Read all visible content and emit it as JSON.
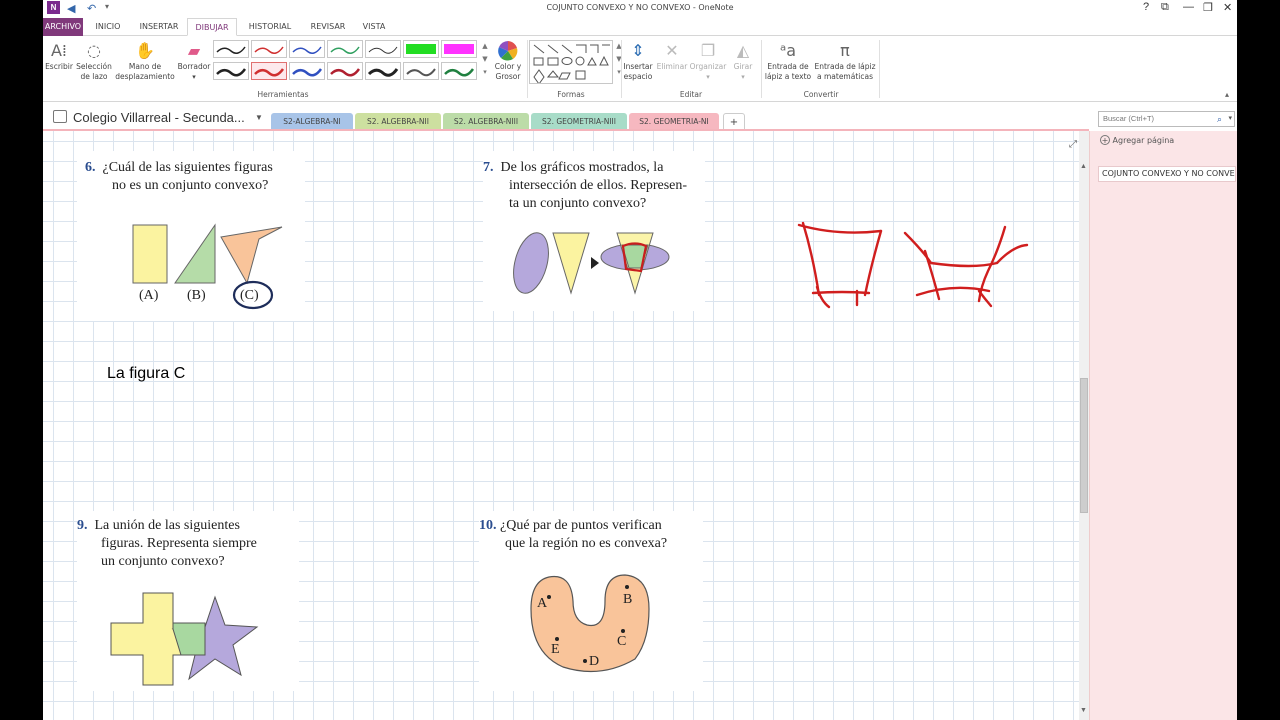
{
  "window": {
    "title": "COJUNTO CONVEXO Y NO CONVEXO - OneNote",
    "logo_text": "N",
    "controls": [
      "?",
      "⧉",
      "—",
      "❐",
      "✕"
    ]
  },
  "tabs": [
    "ARCHIVO",
    "INICIO",
    "INSERTAR",
    "DIBUJAR",
    "HISTORIAL",
    "REVISAR",
    "VISTA"
  ],
  "ribbon": {
    "tools": {
      "write": [
        "Escribir"
      ],
      "lasso": [
        "Selección",
        "de lazo"
      ],
      "pan": [
        "Mano de",
        "desplazamiento"
      ],
      "eraser": [
        "Borrador"
      ],
      "color": [
        "Color y",
        "Grosor"
      ],
      "insert_space": [
        "Insertar",
        "espacio"
      ],
      "delete": [
        "Eliminar"
      ],
      "arrange": [
        "Organizar"
      ],
      "rotate": [
        "Girar"
      ],
      "ink_text": [
        "Entrada de",
        "lápiz a texto"
      ],
      "ink_math": [
        "Entrada de lápiz",
        "a matemáticas"
      ]
    },
    "groups": {
      "tools": "Herramientas",
      "shapes": "Formas",
      "edit": "Editar",
      "convert": "Convertir"
    },
    "pens_row1": [
      "#222222",
      "#d03030",
      "#3050c0",
      "#30a060",
      "#333333",
      "#22dd22",
      "#ff33ff"
    ],
    "pens_row2": [
      "#222222",
      "#d03030",
      "#3050c0",
      "#b02030",
      "#222222",
      "#555555",
      "#208040"
    ]
  },
  "notebook": {
    "name": "Colegio Villarreal - Secunda...",
    "sections": [
      {
        "label": "S2-ALGEBRA-NI",
        "color": "#a8c4e8"
      },
      {
        "label": "S2. ALGEBRA-NII",
        "color": "#cde0a0"
      },
      {
        "label": "S2. ALGEBRA-NIII",
        "color": "#bcdca8"
      },
      {
        "label": "S2. GEOMETRIA-NIII",
        "color": "#a8dcc8"
      },
      {
        "label": "S2. GEOMETRIA-NI",
        "color": "#f6b8c0"
      }
    ],
    "add_section": "+",
    "search_placeholder": "Buscar (Ctrl+T)"
  },
  "right_pane": {
    "add_page": "Agregar página",
    "pages": [
      "COJUNTO CONVEXO Y NO CONVEXO"
    ]
  },
  "questions": {
    "q6": {
      "num": "6.",
      "lines": [
        "¿Cuál de las siguientes figuras",
        "no es un conjunto convexo?"
      ],
      "labels": [
        "(A)",
        "(B)",
        "(C)"
      ]
    },
    "q7": {
      "num": "7.",
      "lines": [
        "De los gráficos mostrados, la",
        "intersección de ellos. Represen-",
        "ta un conjunto convexo?"
      ]
    },
    "q9": {
      "num": "9.",
      "lines": [
        "La unión de las siguientes",
        "figuras. Representa siempre",
        "un conjunto convexo?"
      ]
    },
    "q10": {
      "num": "10.",
      "lines": [
        "¿Qué par de puntos verifican",
        "que la región no es convexa?"
      ],
      "points": [
        "A",
        "B",
        "C",
        "D",
        "E"
      ]
    }
  },
  "answer_text": "La figura C"
}
